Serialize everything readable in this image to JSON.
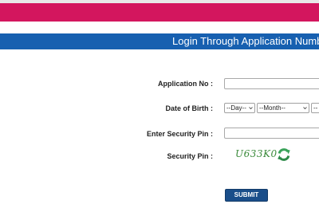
{
  "header": {
    "title": "Login Through Application Number"
  },
  "form": {
    "application_no_label": "Application No :",
    "application_no_value": "",
    "dob_label": "Date of Birth :",
    "dob_day": "--Day--",
    "dob_month": "--Month--",
    "dob_year": "--",
    "security_pin_input_label": "Enter Security Pin :",
    "security_pin_input_value": "",
    "security_pin_label": "Security Pin :",
    "captcha_text": "U633K0",
    "submit_label": "SUBMIT"
  },
  "colors": {
    "top_bar": "#d3165e",
    "title_bar": "#1760b0",
    "submit_button": "#1a4e8a",
    "captcha": "#3a8a3a",
    "refresh_icon": "#3aa35a"
  },
  "icons": {
    "refresh": "refresh-icon",
    "dropdown_caret": "chevron-down-icon"
  }
}
